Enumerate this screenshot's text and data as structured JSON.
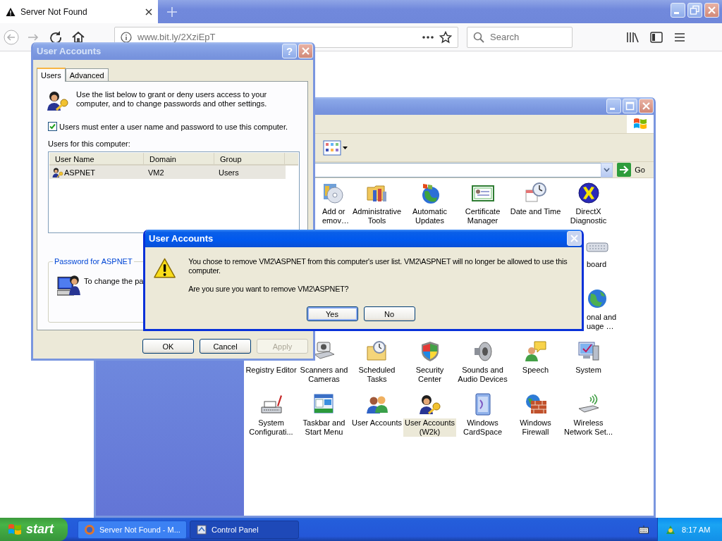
{
  "browser": {
    "tabs": [
      {
        "title": "Server Not Found",
        "selected": true
      }
    ],
    "url": "www.bit.ly/2XziEpT",
    "search": {
      "placeholder": "Search"
    }
  },
  "control_panel": {
    "active": false,
    "go_label": "Go",
    "rows": [
      {
        "items": [
          {
            "kind": "covered"
          },
          {
            "kind": "cut",
            "label": "Add or\nemov…",
            "selected": false
          },
          {
            "kind": "full",
            "label": "Administrative Tools",
            "selected": false
          },
          {
            "kind": "full",
            "label": "Automatic Updates",
            "selected": false
          },
          {
            "kind": "full",
            "label": "Certificate Manager",
            "selected": false
          },
          {
            "kind": "full",
            "label": "Date and Time",
            "selected": false
          },
          {
            "kind": "full",
            "label": "DirectX Diagnostic",
            "selected": false
          }
        ]
      },
      {
        "items": [
          {
            "kind": "covered"
          },
          {
            "kind": "covered"
          },
          {
            "kind": "covered"
          },
          {
            "kind": "covered"
          },
          {
            "kind": "covered"
          },
          {
            "kind": "covered"
          },
          {
            "kind": "cut",
            "label": "board",
            "selected": false
          }
        ]
      },
      {
        "items": [
          {
            "kind": "covered"
          },
          {
            "kind": "covered"
          },
          {
            "kind": "covered"
          },
          {
            "kind": "covered"
          },
          {
            "kind": "covered"
          },
          {
            "kind": "covered"
          },
          {
            "kind": "cut",
            "label": "onal and\nuage …",
            "selected": false
          }
        ]
      },
      {
        "items": [
          {
            "kind": "full",
            "label": "Registry Editor",
            "selected": false
          },
          {
            "kind": "full",
            "label": "Scanners and Cameras",
            "selected": false
          },
          {
            "kind": "full",
            "label": "Scheduled Tasks",
            "selected": false
          },
          {
            "kind": "full",
            "label": "Security Center",
            "selected": false
          },
          {
            "kind": "full",
            "label": "Sounds and Audio Devices",
            "selected": false
          },
          {
            "kind": "full",
            "label": "Speech",
            "selected": false
          },
          {
            "kind": "full",
            "label": "System",
            "selected": false
          }
        ]
      },
      {
        "items": [
          {
            "kind": "full",
            "label": "System Configurati...",
            "selected": false
          },
          {
            "kind": "full",
            "label": "Taskbar and Start Menu",
            "selected": false
          },
          {
            "kind": "full",
            "label": "User Accounts",
            "selected": false
          },
          {
            "kind": "full",
            "label": "User Accounts (W2k)",
            "selected": true
          },
          {
            "kind": "full",
            "label": "Windows CardSpace",
            "selected": false
          },
          {
            "kind": "full",
            "label": "Windows Firewall",
            "selected": false
          },
          {
            "kind": "full",
            "label": "Wireless Network Set...",
            "selected": false
          }
        ]
      }
    ]
  },
  "user_accounts_dialog": {
    "title": "User Accounts",
    "active": false,
    "help_label": "?",
    "tabs": [
      {
        "label": "Users",
        "selected": true
      },
      {
        "label": "Advanced",
        "selected": false
      }
    ],
    "intro": "Use the list below to grant or deny users access to your computer, and to change passwords and other settings.",
    "require_password": {
      "label": "Users must enter a user name and password to use this computer.",
      "checked": true
    },
    "list_label": "Users for this computer:",
    "columns": [
      "User Name",
      "Domain",
      "Group"
    ],
    "rows": [
      {
        "cells": [
          "ASPNET",
          "VM2",
          "Users"
        ],
        "selected": true
      }
    ],
    "password_group": {
      "title": "Password for ASPNET",
      "text": "To change the pa"
    },
    "buttons": [
      {
        "label": "OK",
        "disabled": false
      },
      {
        "label": "Cancel",
        "disabled": false
      },
      {
        "label": "Apply",
        "disabled": true
      }
    ]
  },
  "message_box": {
    "title": "User Accounts",
    "active": true,
    "message": "You chose to remove VM2\\ASPNET from this computer's user list. VM2\\ASPNET will no longer be allowed to use this computer.",
    "question": "Are you sure you want to remove VM2\\ASPNET?",
    "buttons": [
      {
        "label": "Yes",
        "default": true
      },
      {
        "label": "No",
        "default": false
      }
    ]
  },
  "taskbar": {
    "start": "start",
    "tasks": [
      {
        "label": "Server Not Found - M...",
        "selected": false
      },
      {
        "label": "Control Panel",
        "selected": true
      }
    ],
    "clock": "8:17 AM"
  }
}
